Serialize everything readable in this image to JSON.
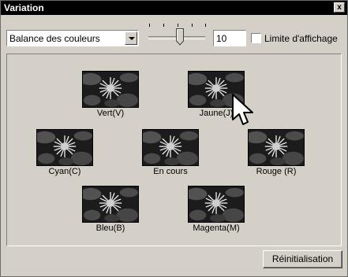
{
  "window": {
    "title": "Variation",
    "close_glyph": "x"
  },
  "toolbar": {
    "mode_select": {
      "value": "Balance des couleurs"
    },
    "slider": {
      "value": 10,
      "tick_count": 5,
      "icon": "slider-thumb"
    },
    "step_field": {
      "value": "10"
    },
    "display_limit": {
      "label": "Limite d'affichage",
      "checked": false
    }
  },
  "variations": [
    {
      "id": "vert",
      "label": "Vert(V)"
    },
    {
      "id": "jaune",
      "label": "Jaune(J)"
    },
    {
      "id": "cyan",
      "label": "Cyan(C)"
    },
    {
      "id": "current",
      "label": "En cours"
    },
    {
      "id": "rouge",
      "label": "Rouge (R)"
    },
    {
      "id": "bleu",
      "label": "Bleu(B)"
    },
    {
      "id": "magenta",
      "label": "Magenta(M)"
    }
  ],
  "buttons": {
    "reset_label": "Réinitialisation"
  },
  "colors": {
    "face": "#d4d0c8",
    "titlebar": "#000000",
    "photo_dark": "#1c1c1c",
    "photo_mid": "#6a6a6a",
    "flower": "#e6e6e6"
  }
}
